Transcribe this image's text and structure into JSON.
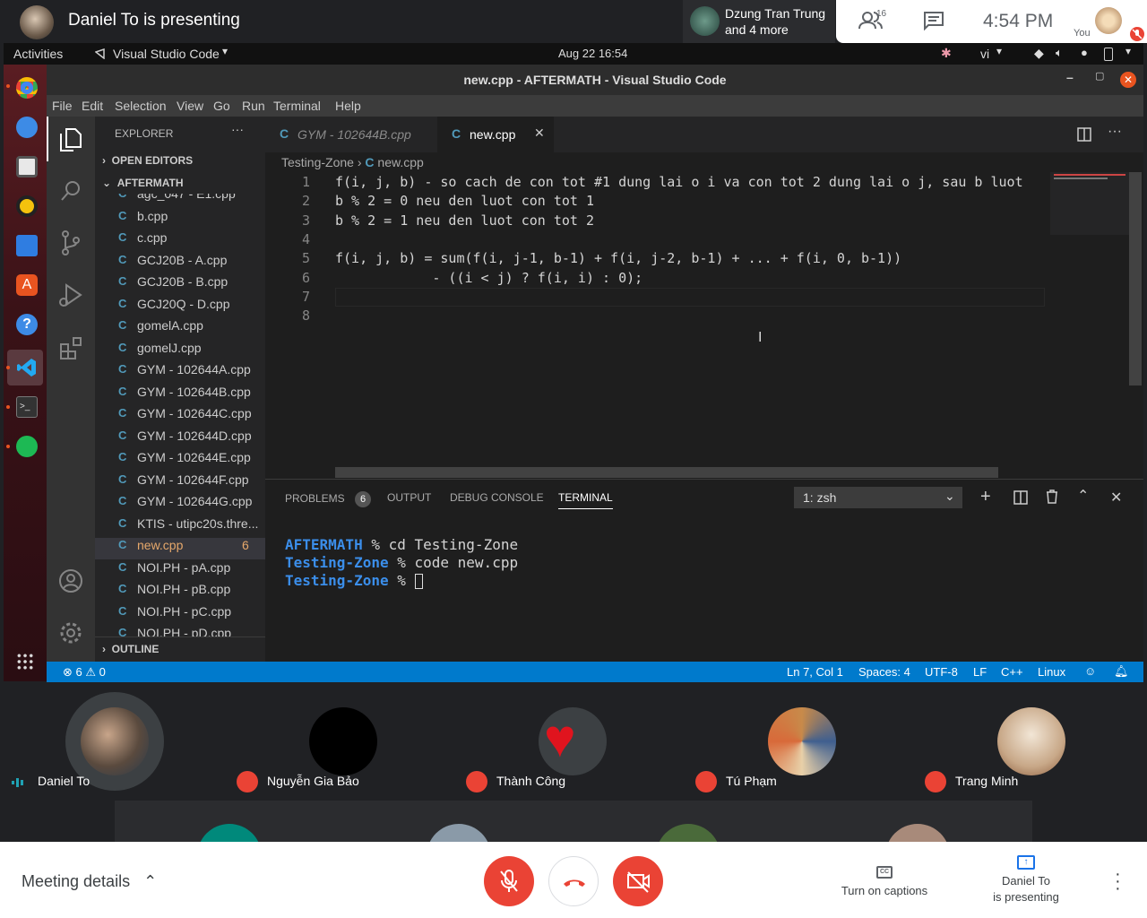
{
  "meet": {
    "presenting_title": "Daniel To is presenting",
    "speaker_line1": "Dzung Tran Trung",
    "speaker_line2": "and 4 more",
    "people_count": "16",
    "time": "4:54 PM",
    "you_label": "You"
  },
  "gnome": {
    "activities": "Activities",
    "app": "Visual Studio Code",
    "datetime": "Aug 22  16:54",
    "lang": "vi"
  },
  "vscode": {
    "window_title": "new.cpp - AFTERMATH - Visual Studio Code",
    "menu": [
      "File",
      "Edit",
      "Selection",
      "View",
      "Go",
      "Run",
      "Terminal",
      "Help"
    ],
    "explorer_label": "EXPLORER",
    "open_editors": "OPEN EDITORS",
    "folder": "AFTERMATH",
    "outline": "OUTLINE",
    "files": [
      "agc_047 - E1.cpp",
      "b.cpp",
      "c.cpp",
      "GCJ20B - A.cpp",
      "GCJ20B - B.cpp",
      "GCJ20Q - D.cpp",
      "gomelA.cpp",
      "gomelJ.cpp",
      "GYM - 102644A.cpp",
      "GYM - 102644B.cpp",
      "GYM - 102644C.cpp",
      "GYM - 102644D.cpp",
      "GYM - 102644E.cpp",
      "GYM - 102644F.cpp",
      "GYM - 102644G.cpp",
      "KTIS - utipc20s.thre...",
      "new.cpp",
      "NOI.PH - pA.cpp",
      "NOI.PH - pB.cpp",
      "NOI.PH - pC.cpp",
      "NOI.PH - pD.cpp"
    ],
    "active_file_badge": "6",
    "tab_inactive": "GYM - 102644B.cpp",
    "tab_active": "new.cpp",
    "breadcrumb_folder": "Testing-Zone",
    "breadcrumb_file": "new.cpp",
    "line_numbers": [
      "1",
      "2",
      "3",
      "4",
      "5",
      "6",
      "7",
      "8"
    ],
    "code_lines": [
      "f(i, j, b) - so cach de con tot #1 dung lai o i va con tot 2 dung lai o j, sau b luot",
      "b % 2 = 0 neu den luot con tot 1",
      "b % 2 = 1 neu den luot con tot 2",
      "",
      "f(i, j, b) = sum(f(i, j-1, b-1) + f(i, j-2, b-1) + ... + f(i, 0, b-1))",
      "            - ((i < j) ? f(i, i) : 0);",
      "",
      ""
    ],
    "panel_tabs": [
      "PROBLEMS",
      "OUTPUT",
      "DEBUG CONSOLE",
      "TERMINAL"
    ],
    "problems_count": "6",
    "terminal_select": "1: zsh",
    "terminal_lines": [
      {
        "dir": "AFTERMATH",
        "cmd": " % cd Testing-Zone"
      },
      {
        "dir": "Testing-Zone",
        "cmd": " % code new.cpp"
      },
      {
        "dir": "Testing-Zone",
        "cmd": " % "
      }
    ],
    "status": {
      "errors": "6",
      "warnings": "0",
      "position": "Ln 7, Col 1",
      "spaces": "Spaces: 4",
      "encoding": "UTF-8",
      "eol": "LF",
      "language": "C++",
      "platform": "Linux"
    }
  },
  "participants": [
    "Daniel To",
    "Nguyễn Gia Bảo",
    "Thành Công",
    "Tú Phạm",
    "Trang Minh"
  ],
  "bottom": {
    "meeting_details": "Meeting details",
    "captions": "Turn on captions",
    "present_line1": "Daniel To",
    "present_line2": "is presenting"
  },
  "colors": {
    "vscode_blue": "#007acc",
    "meet_red": "#ea4335",
    "terminal_dir": "#3b8eea"
  }
}
